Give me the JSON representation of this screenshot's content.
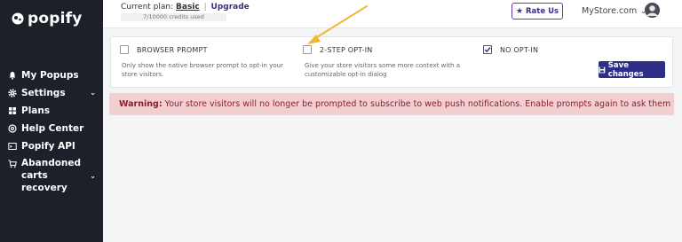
{
  "sidebar": {
    "logo_text": "popify",
    "items": [
      {
        "label": "My Popups",
        "icon": "bell-icon"
      },
      {
        "label": "Settings",
        "icon": "gear-icon",
        "has_chevron": true
      },
      {
        "label": "Plans",
        "icon": "grid-icon"
      },
      {
        "label": "Help Center",
        "icon": "help-icon"
      },
      {
        "label": "Popify API",
        "icon": "terminal-icon"
      },
      {
        "label": "Abandoned carts recovery",
        "icon": "cart-icon",
        "has_chevron": true
      }
    ]
  },
  "topbar": {
    "plan_prefix": "Current plan:",
    "plan_name": "Basic",
    "plan_separator": "|",
    "upgrade_label": "Upgrade",
    "credits_text": "7/10000 credits used",
    "credits_used": 7,
    "credits_total": 10000,
    "rate_label": "Rate Us",
    "store_name": "MyStore.com"
  },
  "options": [
    {
      "label": "BROWSER PROMPT",
      "checked": false,
      "description": "Only show the native browser prompt to opt-in your store visitors."
    },
    {
      "label": "2-STEP OPT-IN",
      "checked": false,
      "description": "Give your store visitors some more context with a customizable opt-in dialog"
    },
    {
      "label": "NO OPT-IN",
      "checked": true,
      "description": ""
    }
  ],
  "save_label": "Save changes",
  "warning": {
    "label": "Warning:",
    "text": "Your store visitors will no longer be prompted to subscribe to web push notifications. Enable prompts again to ask them to subscribe."
  },
  "colors": {
    "sidebar_bg": "#1d2029",
    "accent": "#2d2f87",
    "warning_bg": "#f4cfd1",
    "warning_text": "#8a1f2a",
    "annotation_arrow": "#f2b632"
  }
}
